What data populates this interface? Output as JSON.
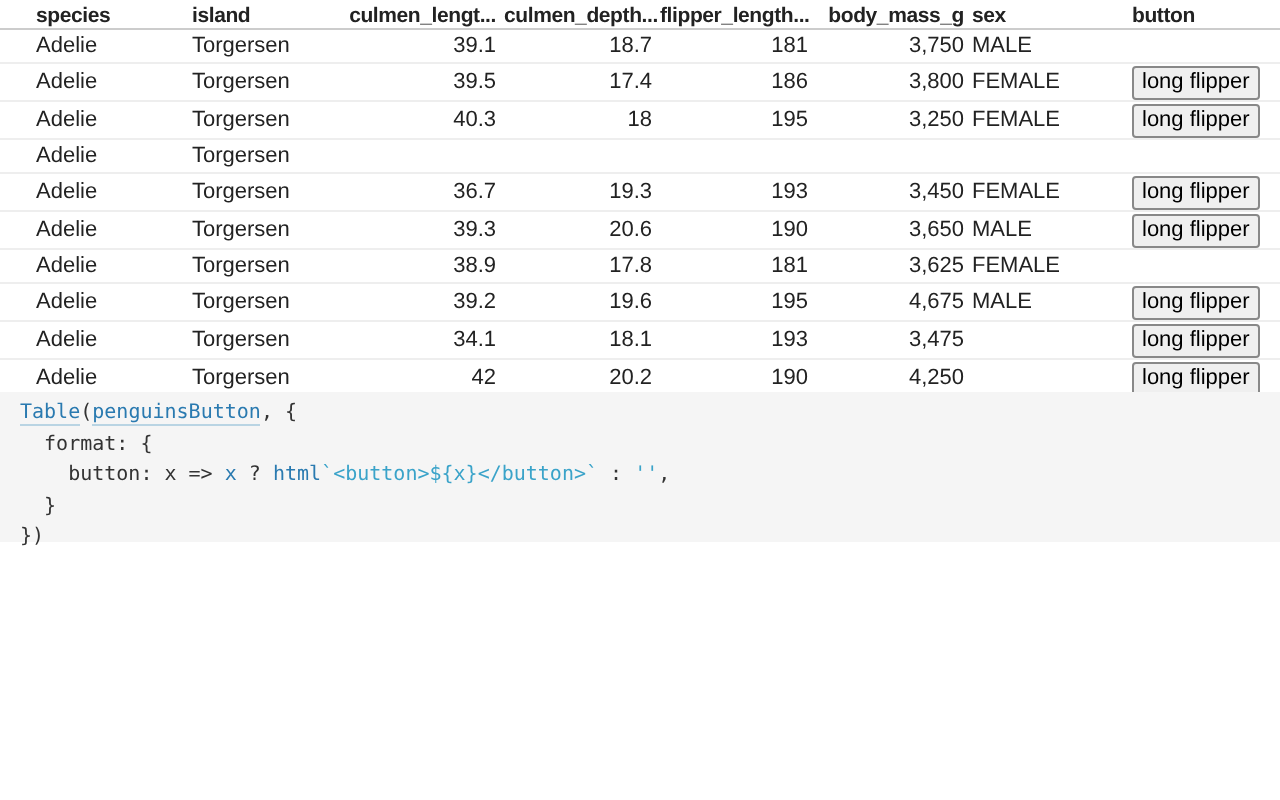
{
  "table": {
    "columns": [
      {
        "label": "species",
        "kind": "text"
      },
      {
        "label": "island",
        "kind": "text"
      },
      {
        "label": "culmen_lengt...",
        "kind": "number"
      },
      {
        "label": "culmen_depth...",
        "kind": "number"
      },
      {
        "label": "flipper_length...",
        "kind": "number"
      },
      {
        "label": "body_mass_g",
        "kind": "number"
      },
      {
        "label": "sex",
        "kind": "text"
      },
      {
        "label": "button",
        "kind": "button"
      }
    ],
    "rows": [
      [
        "Adelie",
        "Torgersen",
        "39.1",
        "18.7",
        "181",
        "3,750",
        "MALE",
        null
      ],
      [
        "Adelie",
        "Torgersen",
        "39.5",
        "17.4",
        "186",
        "3,800",
        "FEMALE",
        "long flipper"
      ],
      [
        "Adelie",
        "Torgersen",
        "40.3",
        "18",
        "195",
        "3,250",
        "FEMALE",
        "long flipper"
      ],
      [
        "Adelie",
        "Torgersen",
        null,
        null,
        null,
        null,
        null,
        null
      ],
      [
        "Adelie",
        "Torgersen",
        "36.7",
        "19.3",
        "193",
        "3,450",
        "FEMALE",
        "long flipper"
      ],
      [
        "Adelie",
        "Torgersen",
        "39.3",
        "20.6",
        "190",
        "3,650",
        "MALE",
        "long flipper"
      ],
      [
        "Adelie",
        "Torgersen",
        "38.9",
        "17.8",
        "181",
        "3,625",
        "FEMALE",
        null
      ],
      [
        "Adelie",
        "Torgersen",
        "39.2",
        "19.6",
        "195",
        "4,675",
        "MALE",
        "long flipper"
      ],
      [
        "Adelie",
        "Torgersen",
        "34.1",
        "18.1",
        "193",
        "3,475",
        null,
        "long flipper"
      ],
      [
        "Adelie",
        "Torgersen",
        "42",
        "20.2",
        "190",
        "4,250",
        null,
        "long flipper"
      ]
    ]
  },
  "code": {
    "lines": [
      [
        {
          "kind": "ref",
          "text": "Table"
        },
        {
          "kind": "plain",
          "text": "("
        },
        {
          "kind": "ref",
          "text": "penguinsButton"
        },
        {
          "kind": "plain",
          "text": ", {"
        }
      ],
      [
        {
          "kind": "plain",
          "text": "  format: {"
        }
      ],
      [
        {
          "kind": "plain",
          "text": "    button: x => "
        },
        {
          "kind": "var",
          "text": "x"
        },
        {
          "kind": "plain",
          "text": " ? "
        },
        {
          "kind": "var",
          "text": "html"
        },
        {
          "kind": "string",
          "text": "`<button>${x}</button>`"
        },
        {
          "kind": "plain",
          "text": " : "
        },
        {
          "kind": "string",
          "text": "''"
        },
        {
          "kind": "plain",
          "text": ","
        }
      ],
      [
        {
          "kind": "plain",
          "text": "  }"
        }
      ],
      [
        {
          "kind": "plain",
          "text": "})"
        }
      ]
    ]
  }
}
